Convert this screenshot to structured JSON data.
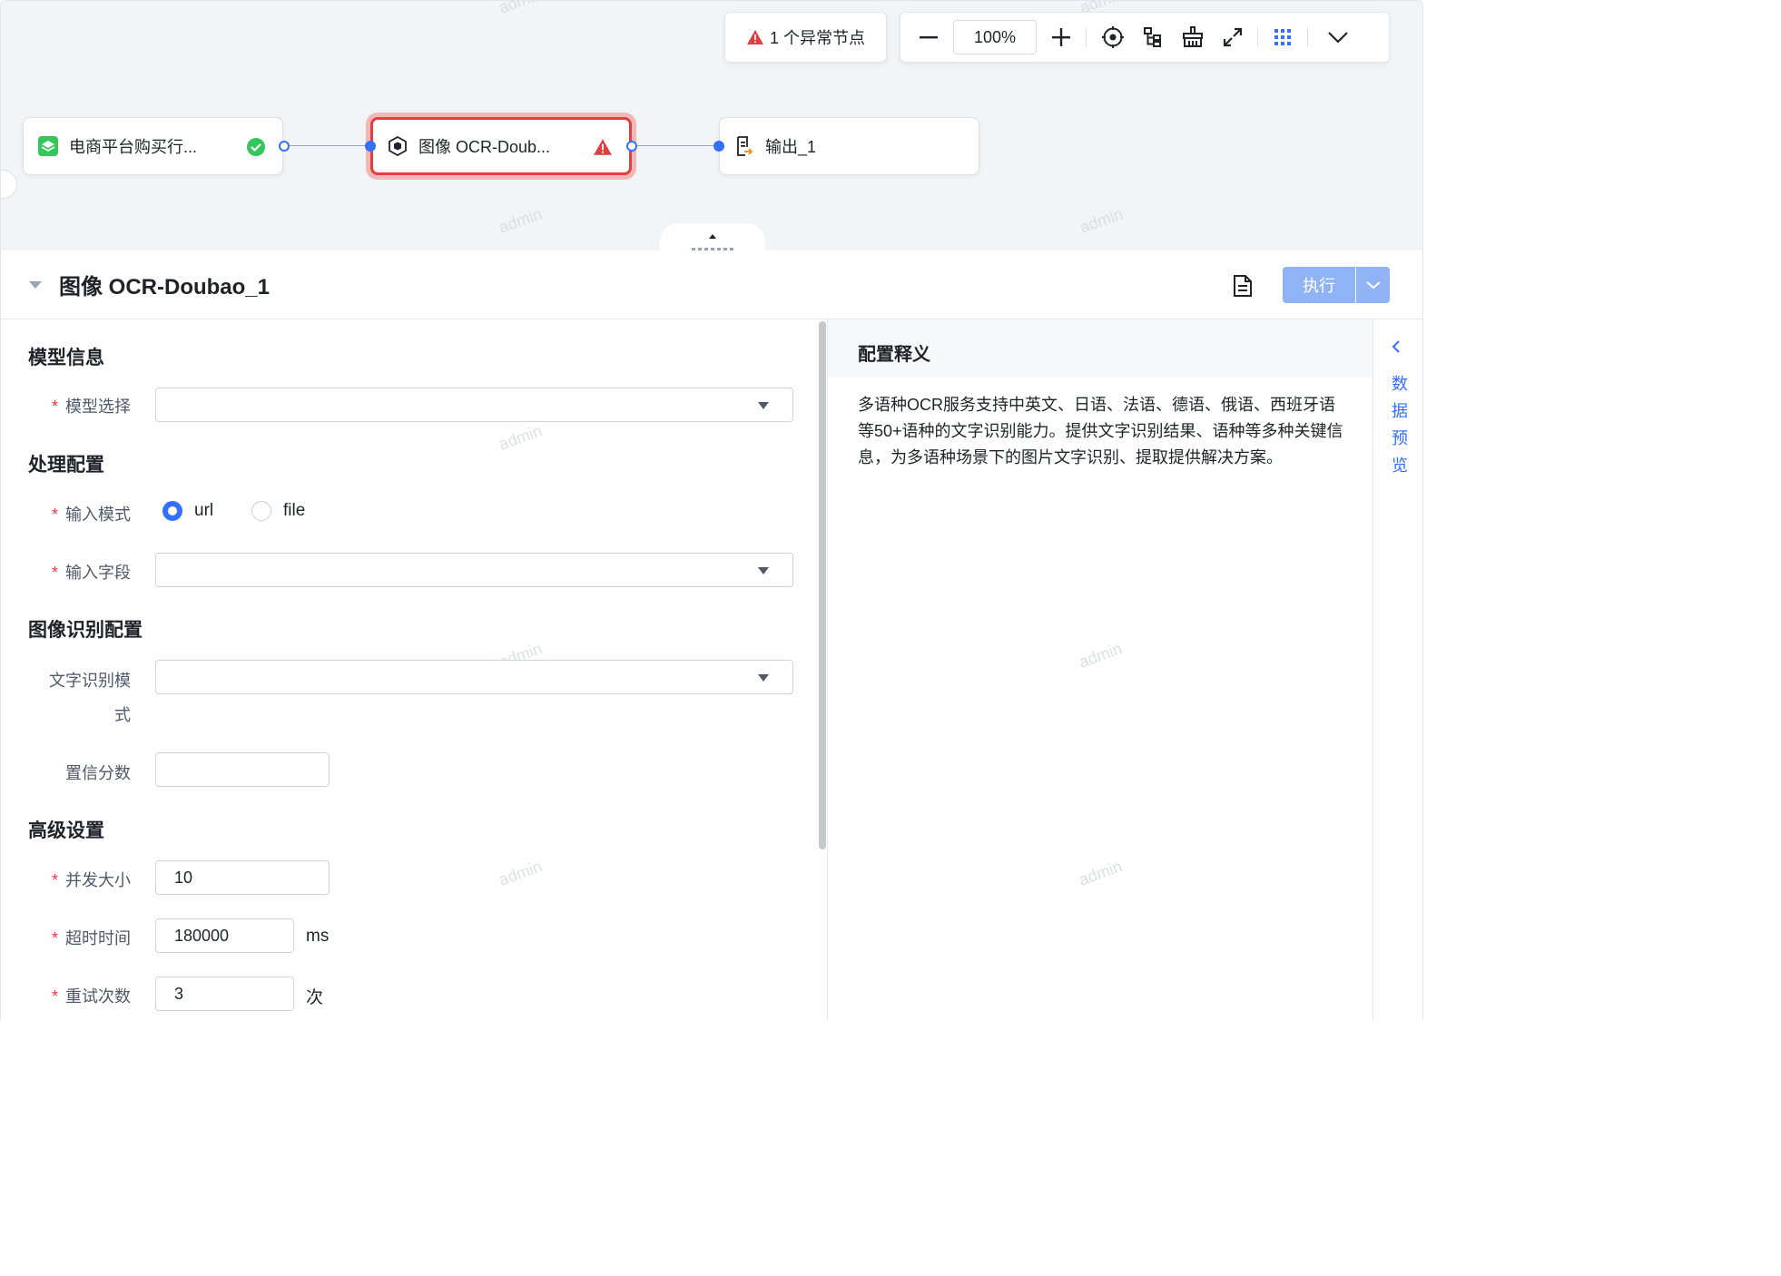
{
  "toolbar": {
    "alert_label": "1 个异常节点",
    "zoom_level": "100%"
  },
  "nodes": [
    {
      "label": "电商平台购买行...",
      "status": "success"
    },
    {
      "label": "图像 OCR-Doub...",
      "status": "error"
    },
    {
      "label": "输出_1",
      "status": "none"
    }
  ],
  "panel": {
    "title": "图像 OCR-Doubao_1",
    "execute_label": "执行"
  },
  "form": {
    "section_model": "模型信息",
    "model_select_label": "模型选择",
    "section_process": "处理配置",
    "input_mode_label": "输入模式",
    "input_mode_options": [
      "url",
      "file"
    ],
    "input_mode_selected": "url",
    "input_field_label": "输入字段",
    "section_image": "图像识别配置",
    "text_mode_label_1": "文字识别模",
    "text_mode_label_2": "式",
    "confidence_label": "置信分数",
    "section_advanced": "高级设置",
    "concurrency_label": "并发大小",
    "concurrency_value": "10",
    "timeout_label": "超时时间",
    "timeout_value": "180000",
    "timeout_unit": "ms",
    "retry_label": "重试次数",
    "retry_value": "3",
    "retry_unit": "次"
  },
  "description": {
    "title": "配置释义",
    "text": "多语种OCR服务支持中英文、日语、法语、德语、俄语、西班牙语等50+语种的文字识别能力。提供文字识别结果、语种等多种关键信息，为多语种场景下的图片文字识别、提取提供解决方案。"
  },
  "side_rail": {
    "label": "数据预览"
  },
  "watermark": "admin",
  "colors": {
    "accent": "#3370ff",
    "error": "#e43d3d",
    "success": "#34c759",
    "execute_disabled": "#8fb3f5"
  }
}
